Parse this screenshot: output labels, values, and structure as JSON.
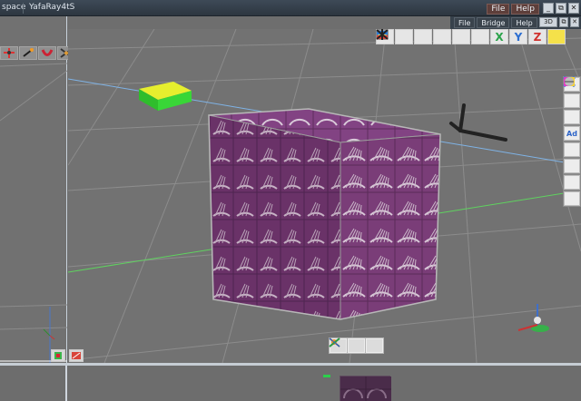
{
  "tabs": {
    "workspace": "space",
    "yafaray": "YafaRay4tS"
  },
  "top_menu": {
    "file": "File",
    "help": "Help"
  },
  "sub_menu": {
    "file": "File",
    "bridge": "Bridge",
    "help": "Help",
    "view_3d": "3D"
  },
  "window_buttons": {
    "minimize": "_",
    "restore": "⧉",
    "close": "✕"
  },
  "colors": {
    "viewport_bg": "#727272",
    "grid_line": "#8d8d8d",
    "axis_blue": "#7fb3e6",
    "axis_green": "#5fd35f",
    "cube_purple": "#7a3d78",
    "accent_menu": "#5d3e3a"
  },
  "viewport_toolbar_icons": [
    "cube-orange-icon",
    "cube-wire-icon",
    "grid-icon",
    "house-icon",
    "stack-icon",
    "axes-icon",
    "x-axis-icon",
    "y-axis-icon",
    "z-axis-icon",
    "star-icon"
  ],
  "viewport_toolbar_letters": {
    "x": "X",
    "y": "Y",
    "z": "Z"
  },
  "right_toolbar_icons": [
    "teapot-icon",
    "sphere-icon",
    "trophy-icon",
    "ad-icon",
    "scene-icon",
    "cross-icon",
    "gradient-icon",
    "sphere-stripes-icon"
  ],
  "right_toolbar_labels": {
    "ad": "Ad"
  },
  "left_toolbar_icons": [
    "move-icon",
    "brush-icon",
    "magnet-icon",
    "pinwheel-icon",
    "arrow-up-icon",
    "arrows-icon"
  ]
}
